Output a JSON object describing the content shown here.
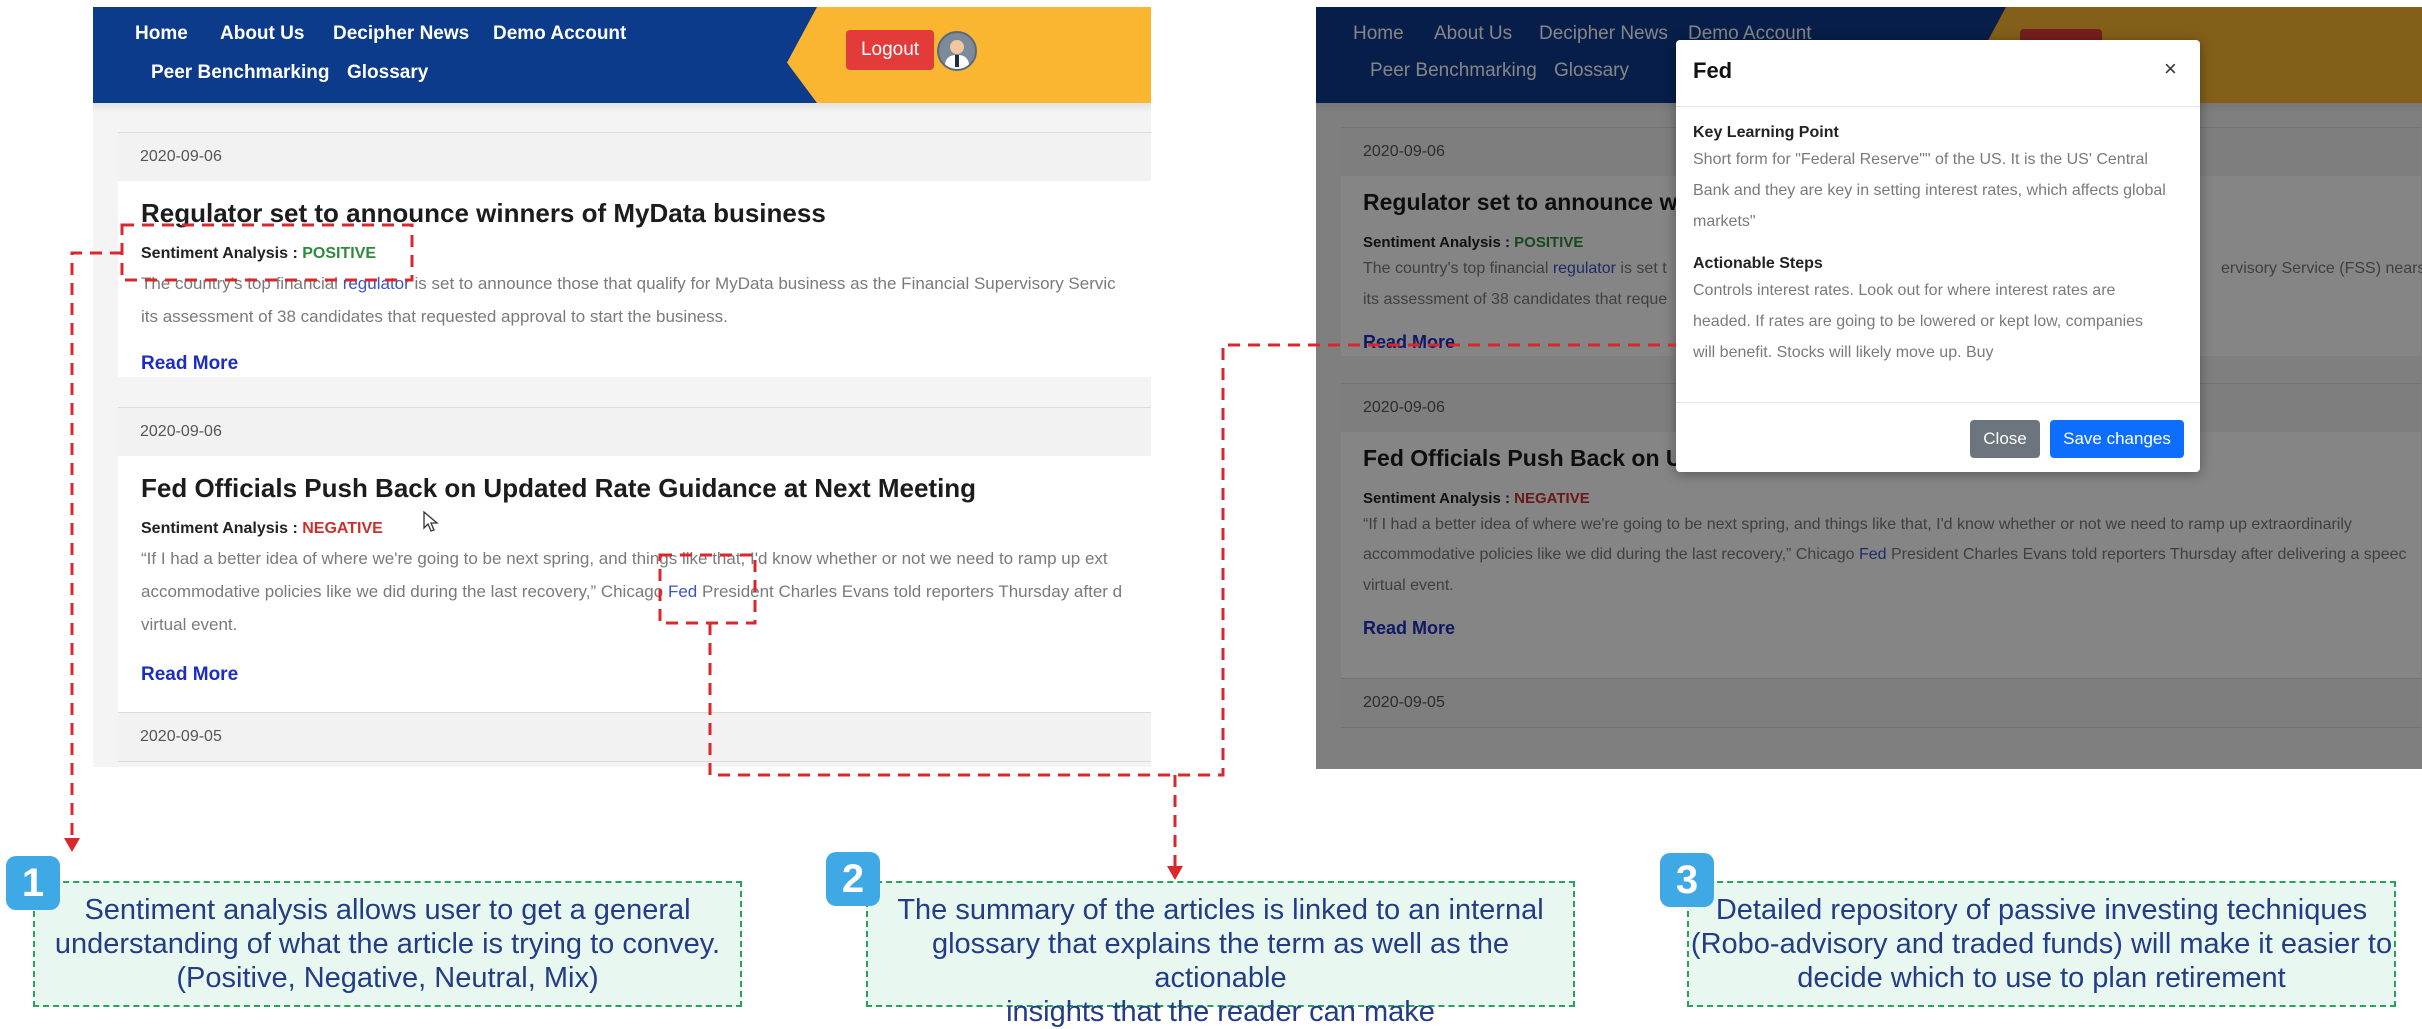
{
  "nav": {
    "items": [
      "Home",
      "About Us",
      "Decipher News",
      "Demo Account",
      "Peer Benchmarking",
      "Glossary"
    ],
    "logout_label": "Logout"
  },
  "articles": [
    {
      "date": "2020-09-06",
      "title": "Regulator set to announce winners of MyData business",
      "sentiment_label": "Sentiment Analysis : ",
      "sentiment_value": "POSITIVE",
      "summary_left": {
        "line1_pre": "The country's top financial ",
        "line1_link": "regulator",
        "line1_post": " is set to announce those that qualify for MyData business as the Financial Supervisory Servic",
        "line2": "its assessment of 38 candidates that requested approval to start the business."
      },
      "summary_right": {
        "line1_pre": "The country's top financial ",
        "line1_link": "regulator",
        "line1_post": " is set t",
        "line1_tail": "ervisory Service (FSS) nears co",
        "line2": "its assessment of 38 candidates that reque"
      },
      "title_right_prefix": "Regulator set to announce w",
      "read_more": "Read More"
    },
    {
      "date": "2020-09-06",
      "title": "Fed Officials Push Back on Updated Rate Guidance at Next Meeting",
      "sentiment_label": "Sentiment Analysis : ",
      "sentiment_value": "NEGATIVE",
      "summary_left": {
        "line1": "“If I had a better idea of where we're going to be next spring, and things like that, I'd know whether or not we need to ramp up ext",
        "line2_pre": "accommodative policies like we did during the last recovery,” Chicago ",
        "line2_link": "Fed",
        "line2_post": " President Charles Evans told reporters Thursday after d",
        "line3": "virtual event."
      },
      "summary_right": {
        "line1": "“If I had a better idea of where we're going to be next spring, and things like that, I'd know whether or not we need to ramp up extraordinarily",
        "line2_pre": "accommodative policies like we did during the last recovery,” Chicago ",
        "line2_link": "Fed",
        "line2_post": " President Charles Evans told reporters Thursday after delivering a speec",
        "line3": "virtual event."
      },
      "title_right_prefix": "Fed Officials Push Back on U",
      "read_more": "Read More"
    },
    {
      "date": "2020-09-05"
    }
  ],
  "modal": {
    "title": "Fed",
    "close_symbol": "×",
    "key_point_heading": "Key Learning Point",
    "key_point_lines": [
      "Short form for \"Federal Reserve\"\" of the US. It is the US' Central",
      "Bank and they are key in setting interest rates, which affects global",
      "markets\""
    ],
    "actionable_heading": "Actionable Steps",
    "actionable_lines": [
      "Controls interest rates. Look out for where interest rates are",
      "headed. If rates are going to be lowered or kept low, companies",
      "will benefit. Stocks will likely move up. Buy"
    ],
    "close_button": "Close",
    "save_button": "Save changes"
  },
  "callouts": [
    {
      "number": "1",
      "lines": [
        "Sentiment analysis allows user to get a general",
        "understanding of what the article is trying to convey.",
        "(Positive, Negative, Neutral, Mix)"
      ]
    },
    {
      "number": "2",
      "lines": [
        "The summary of the articles is linked to an internal",
        "glossary that explains the term as well as the actionable",
        "insights that the reader can make"
      ]
    },
    {
      "number": "3",
      "lines": [
        "Detailed repository of passive investing techniques",
        "(Robo-advisory and traded funds) will make it easier to",
        "decide which to use to plan retirement"
      ]
    }
  ],
  "colors": {
    "nav_blue": "#0d3b8c",
    "nav_yellow": "#fbb631",
    "logout_red": "#e33a3a",
    "positive_green": "#2e8b3c",
    "negative_red": "#c9302c",
    "read_more_blue": "#1b2ec0",
    "annotation_red": "#d9272e",
    "callout_green_border": "#29a35c",
    "callout_text_blue": "#233c86",
    "badge_blue": "#3fa9e6"
  },
  "icons": {
    "avatar": "user-avatar-icon",
    "close": "close-icon",
    "cursor": "mouse-cursor-icon"
  }
}
